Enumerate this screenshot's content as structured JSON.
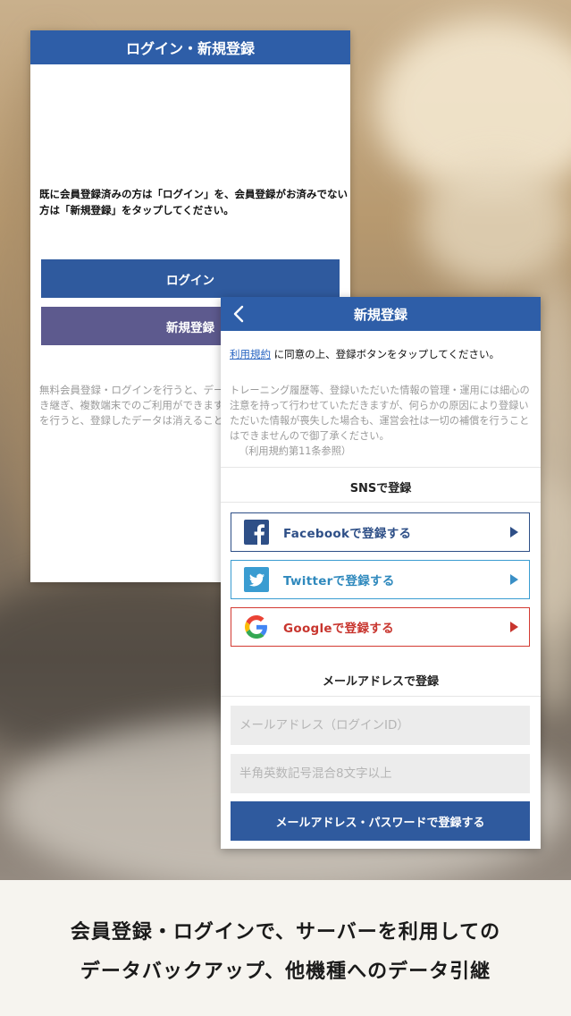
{
  "login_screen": {
    "title": "ログイン・新規登録",
    "intro": "既に会員登録済みの方は「ログイン」を、会員登録がお済みでない方は「新規登録」をタップしてください。",
    "login_button": "ログイン",
    "register_button": "新規登録",
    "note": "無料会員登録・ログインを行うと、データ機種変更時のデータの引き継ぎ、複数端末でのご利用ができます。無料会員登録・ログインを行うと、登録したデータは消えることなく、引き継がれます。"
  },
  "register_screen": {
    "title": "新規登録",
    "terms_link": "利用規約",
    "agree_text": " に同意の上、登録ボタンをタップしてください。",
    "notice": "トレーニング履歴等、登録いただいた情報の管理・運用には細心の注意を持って行わせていただきますが、何らかの原因により登録いただいた情報が喪失した場合も、運営会社は一切の補償を行うことはできませんので御了承ください。",
    "notice_ref": "（利用規約第11条参照）",
    "sns_section_title": "SNSで登録",
    "facebook_button": "Facebookで登録する",
    "twitter_button": "Twitterで登録する",
    "google_button": "Googleで登録する",
    "email_section_title": "メールアドレスで登録",
    "email_placeholder": "メールアドレス（ログインID）",
    "password_placeholder": "半角英数記号混合8文字以上",
    "submit_button": "メールアドレス・パスワードで登録する"
  },
  "caption": {
    "line1": "会員登録・ログインで、サーバーを利用しての",
    "line2": "データバックアップ、他機種へのデータ引継"
  },
  "colors": {
    "header_blue": "#2e5ea8",
    "register_purple": "#5d5a8e",
    "facebook": "#2e4f87",
    "twitter": "#3a9cd1",
    "google": "#d33a32"
  },
  "icons": [
    "chevron-left-icon",
    "facebook-icon",
    "twitter-icon",
    "google-icon",
    "play-arrow-icon"
  ]
}
